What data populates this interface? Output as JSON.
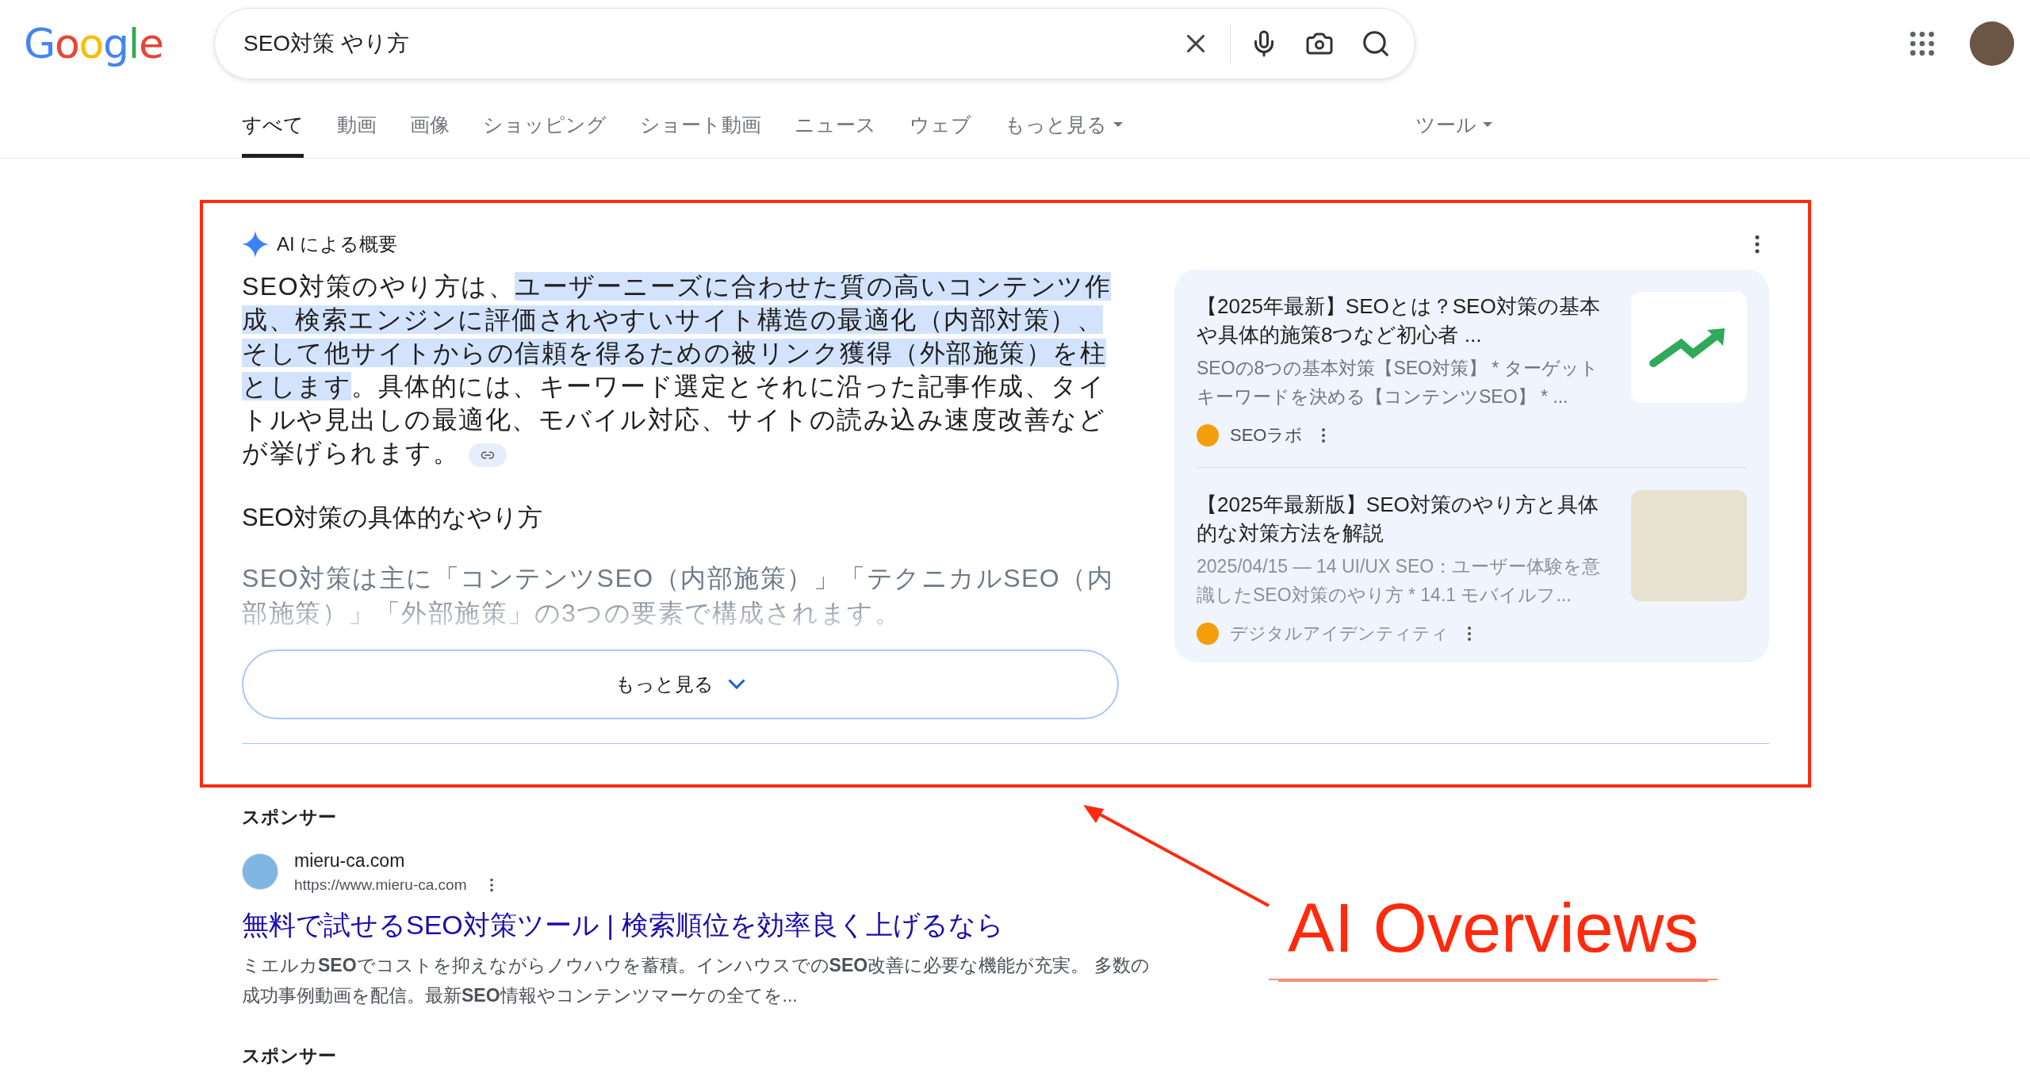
{
  "logo": "Google",
  "search": {
    "value": "SEO対策 やり方"
  },
  "tabs": [
    {
      "label": "すべて",
      "selected": true
    },
    {
      "label": "動画",
      "selected": false
    },
    {
      "label": "画像",
      "selected": false
    },
    {
      "label": "ショッピング",
      "selected": false
    },
    {
      "label": "ショート動画",
      "selected": false
    },
    {
      "label": "ニュース",
      "selected": false
    },
    {
      "label": "ウェブ",
      "selected": false
    },
    {
      "label": "もっと見る",
      "selected": false,
      "kind": "menu"
    }
  ],
  "tools": "ツール",
  "ai_overview": {
    "title": "AI による概要",
    "summary": [
      {
        "text": "SEO対策のやり方は、",
        "highlighted": false
      },
      {
        "text": "ユーザーニーズに合わせた質の高いコンテンツ作成、検索エンジンに評価されやすいサイト構造の最適化（内部対策）、そして他サイトからの信頼を得るための被リンク獲得（外部施策）を柱とします",
        "highlighted": true
      },
      {
        "text": "。具体的には、キーワード選定とそれに沿った記事作成、タイトルや見出しの最適化、モバイル対応、サイトの読み込み速度改善などが挙げられます。",
        "highlighted": false
      }
    ],
    "heading": "SEO対策の具体的なやり方",
    "faded_text": "SEO対策は主に「コンテンツSEO（内部施策）」「テクニカルSEO（内部施策）」「外部施策」の3つの要素で構成されます。",
    "more_button": "もっと見る",
    "sources": [
      {
        "title": "【2025年最新】SEOとは？SEO対策の基本や具体的施策8つなど初心者 ...",
        "snippet": "SEOの8つの基本対策【SEO対策】 * ターゲットキーワードを決める【コンテンツSEO】 * ...",
        "site": "SEOラボ",
        "kind": "seo-logo"
      },
      {
        "title": "【2025年最新版】SEO対策のやり方と具体的な対策方法を解説",
        "snippet": "2025/04/15 — 14 UI/UX SEO：ユーザー体験を意識したSEO対策のやり方 * 14.1 モバイルフ...",
        "site": "デジタルアイデンティティ",
        "kind": "photo"
      }
    ]
  },
  "sponsored": [
    {
      "label": "スポンサー",
      "site": "mieru-ca.com",
      "url": "https://www.mieru-ca.com",
      "title": "無料で試せるSEO対策ツール | 検索順位を効率良く上げるなら",
      "description": "ミエルカ**SEO**でコストを抑えながらノウハウを蓄積。インハウスでの**SEO**改善に必要な機能が充実。 多数の成功事例動画を配信。最新**SEO**情報やコンテンツマーケの全てを..."
    },
    {
      "label": "スポンサー"
    }
  ],
  "annotation": "AI Overviews"
}
